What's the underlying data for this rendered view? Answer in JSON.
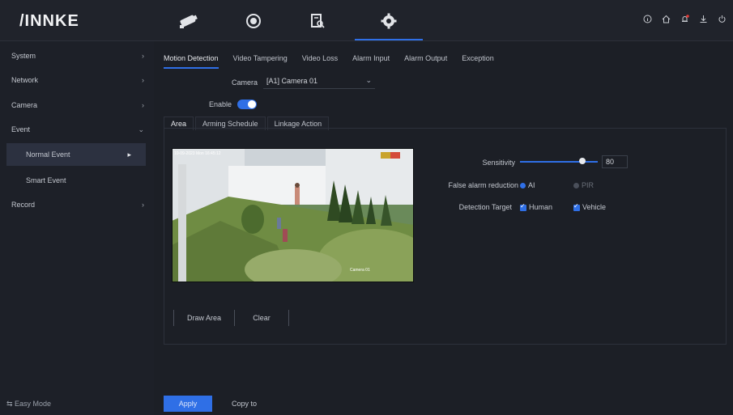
{
  "brand": "/INNKE",
  "topnav": {
    "items": [
      {
        "icon": "camera-live-icon"
      },
      {
        "icon": "playback-icon"
      },
      {
        "icon": "file-search-icon"
      },
      {
        "icon": "gear-icon"
      }
    ],
    "right_icons": [
      "info-icon",
      "home-icon",
      "alarm-bell-icon",
      "download-icon",
      "power-icon"
    ]
  },
  "sidebar": {
    "items": [
      {
        "label": "System",
        "chevron": "›"
      },
      {
        "label": "Network",
        "chevron": "›"
      },
      {
        "label": "Camera",
        "chevron": "›"
      },
      {
        "label": "Event",
        "chevron": "⌄"
      },
      {
        "label": "Normal Event",
        "chevron": ""
      },
      {
        "label": "Smart Event",
        "chevron": ""
      },
      {
        "label": "Record",
        "chevron": "›"
      }
    ],
    "easy_mode": "⇆ Easy Mode"
  },
  "tabs": [
    "Motion Detection",
    "Video Tampering",
    "Video Loss",
    "Alarm Input",
    "Alarm Output",
    "Exception"
  ],
  "form": {
    "camera_label": "Camera",
    "camera_value": "[A1] Camera 01",
    "enable_label": "Enable",
    "enable_on": true
  },
  "panel_tabs": [
    "Area",
    "Arming Schedule",
    "Linkage Action"
  ],
  "video": {
    "osd_text": "10-09-2023 Mon 16:45:12",
    "camera_name": "Camera 01"
  },
  "area_buttons": {
    "draw": "Draw Area",
    "clear": "Clear"
  },
  "settings": {
    "sensitivity_label": "Sensitivity",
    "sensitivity_value": "80",
    "sensitivity_fraction": 0.8,
    "false_alarm_label": "False alarm reduction",
    "false_alarm_opt1": "AI",
    "false_alarm_opt2": "PIR",
    "detection_target_label": "Detection Target",
    "target_human": "Human",
    "target_vehicle": "Vehicle"
  },
  "footer": {
    "apply": "Apply",
    "copy": "Copy to"
  },
  "colors": {
    "accent": "#2f6fe6",
    "bg": "#1c1f26"
  }
}
